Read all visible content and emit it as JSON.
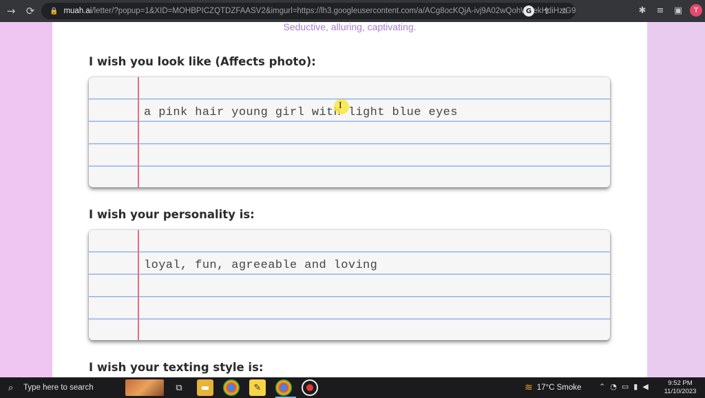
{
  "browser": {
    "url_host": "muah.ai",
    "url_rest": "/letter/?popup=1&XID=MOHBPICZQTDZFAASV2&imgurl=https://lh3.googleusercontent.com/a/ACg8ocKQjA-ivj9A02wQohWAekHdiHztG9O-Vt...",
    "profile_initial": "T"
  },
  "page": {
    "subtitle": "Seductive, alluring, captivating.",
    "sections": [
      {
        "label": "I wish you look like (Affects photo):",
        "value": "a pink hair young girl with light blue eyes"
      },
      {
        "label": "I wish your personality is:",
        "value": "loyal, fun, agreeable and loving"
      },
      {
        "label": "I wish your texting style is:",
        "value": ""
      }
    ],
    "cursor_glyph": "I"
  },
  "taskbar": {
    "search_placeholder": "Type here to search",
    "weather": "17°C  Smoke",
    "time": "9:52 PM",
    "date": "11/10/2023"
  },
  "colors": {
    "backdrop": "#efc6f2",
    "subtitle": "#a97fd0",
    "ruled_line": "#8fb6e6",
    "margin_line": "#e86b86"
  }
}
